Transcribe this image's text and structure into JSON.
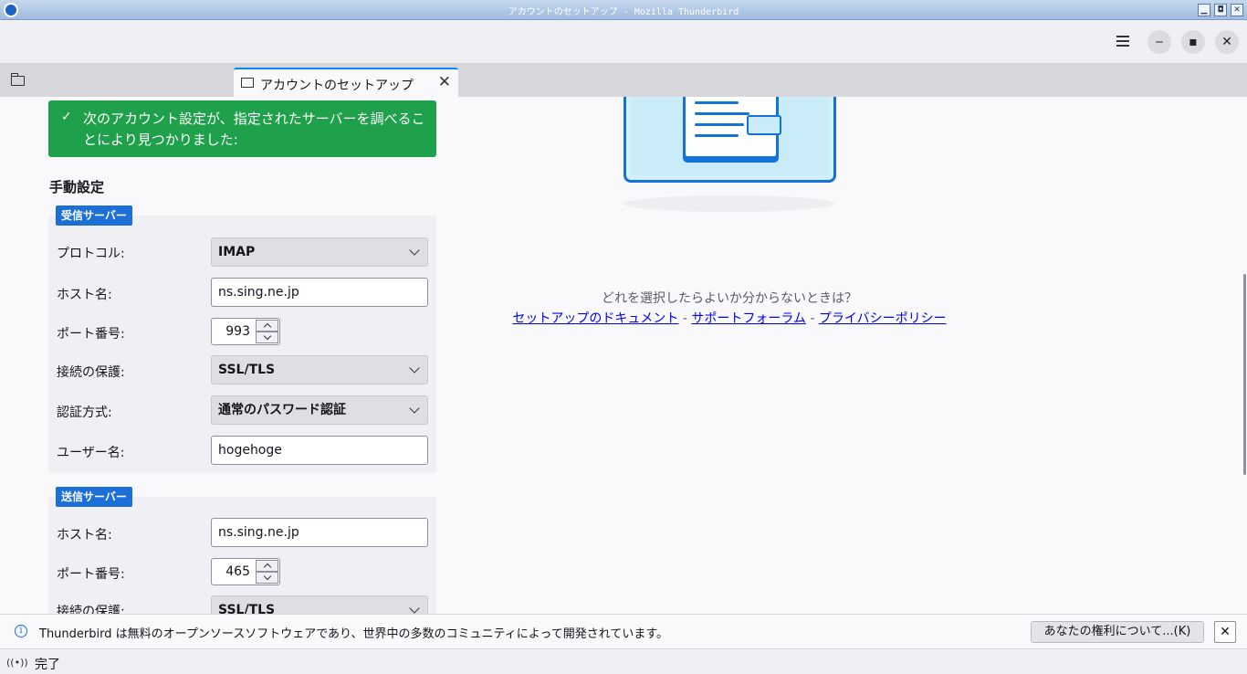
{
  "window": {
    "title": "アカウントのセットアップ - Mozilla Thunderbird",
    "min": "▁",
    "max": "◘",
    "close": "✕"
  },
  "toolbar": {
    "minimize": "‒",
    "maximize": "▪",
    "close": "✕"
  },
  "tab": {
    "label": "アカウントのセットアップ",
    "close": "✕"
  },
  "success_banner": {
    "check": "✓",
    "text": "次のアカウント設定が、指定されたサーバーを調べることにより見つかりました:"
  },
  "manual": {
    "title": "手動設定",
    "incoming": {
      "badge": "受信サーバー",
      "protocol_label": "プロトコル:",
      "protocol_value": "IMAP",
      "host_label": "ホスト名:",
      "host_value": "ns.sing.ne.jp",
      "port_label": "ポート番号:",
      "port_value": "993",
      "security_label": "接続の保護:",
      "security_value": "SSL/TLS",
      "auth_label": "認証方式:",
      "auth_value": "通常のパスワード認証",
      "user_label": "ユーザー名:",
      "user_value": "hogehoge"
    },
    "outgoing": {
      "badge": "送信サーバー",
      "host_label": "ホスト名:",
      "host_value": "ns.sing.ne.jp",
      "port_label": "ポート番号:",
      "port_value": "465",
      "security_label": "接続の保護:",
      "security_value": "SSL/TLS"
    }
  },
  "help": {
    "question": "どれを選択したらよいか分からないときは？",
    "docs_link": "セットアップのドキュメント",
    "forum_link": "サポートフォーラム",
    "privacy_link": "プライバシーポリシー",
    "separator": " - "
  },
  "notice": {
    "info": "i",
    "message": "Thunderbird は無料のオープンソースソフトウェアであり、世界中の多数のコミュニティによって開発されています。",
    "rights_button": "あなたの権利について...(K)",
    "close": "✕"
  },
  "status": {
    "activity_icon": "((•))",
    "text": "完了"
  }
}
